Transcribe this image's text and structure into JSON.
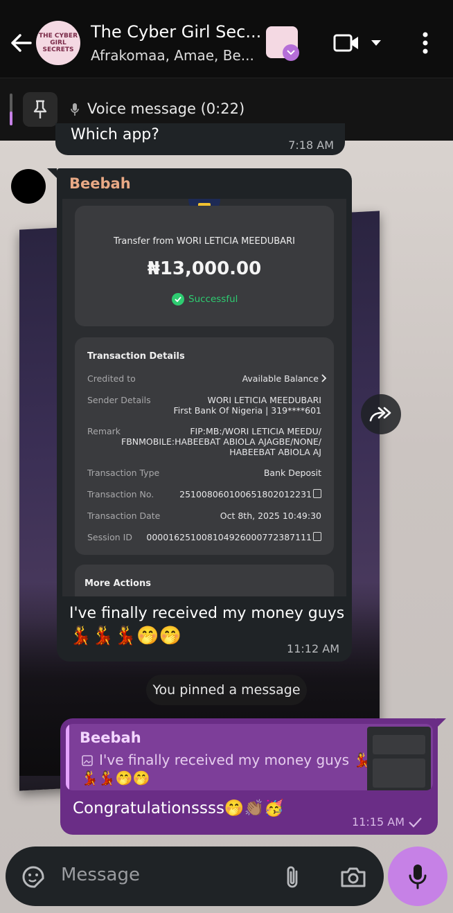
{
  "header": {
    "title": "The Cyber Girl Sec...",
    "subtitle": "Afrakomaa, Amae, Be...",
    "avatar_text": "THE CYBER GIRL SECRETS"
  },
  "pinned": {
    "label": "Voice message (0:22)"
  },
  "prev_message": {
    "text": "Which app?",
    "time": "7:18 AM"
  },
  "receipt_message": {
    "sender": "Beebah",
    "receipt": {
      "title": "Transfer from WORI LETICIA MEEDUBARI",
      "amount": "₦13,000.00",
      "status": "Successful",
      "details_heading": "Transaction Details",
      "rows": [
        {
          "label": "Credited to",
          "value": "Available Balance"
        },
        {
          "label": "Sender Details",
          "value": "WORI LETICIA MEEDUBARI",
          "value2": "First Bank Of Nigeria | 319****601"
        },
        {
          "label": "Remark",
          "value": "FIP:MB:/WORI LETICIA MEEDU/",
          "value2": "FBNMOBILE:HABEEBAT ABIOLA AJAGBE/NONE/",
          "value3": "HABEEBAT ABIOLA AJ"
        },
        {
          "label": "Transaction Type",
          "value": "Bank Deposit"
        },
        {
          "label": "Transaction No.",
          "value": "251008060100651802012231"
        },
        {
          "label": "Transaction Date",
          "value": "Oct 8th, 2025 10:49:30"
        },
        {
          "label": "Session ID",
          "value": "000016251008104926000772387111"
        }
      ],
      "more_actions": "More Actions"
    },
    "caption": "I've finally received my money guys",
    "emojis": "💃💃💃🤭🤭",
    "time": "11:12 AM"
  },
  "service_message": "You pinned a message",
  "reply_message": {
    "quoted_sender": "Beebah",
    "quoted_text": "I've finally received my money guys 💃",
    "quoted_text2": "💃💃🤭🤭",
    "text": "Congratulationssss🤭👏🏽🥳",
    "time": "11:15 AM"
  },
  "input": {
    "placeholder": "Message"
  },
  "colors": {
    "accent_purple": "#6a2d86",
    "mic_button": "#c681e6",
    "sender_name": "#e8a985",
    "success_green": "#2ecc71"
  }
}
